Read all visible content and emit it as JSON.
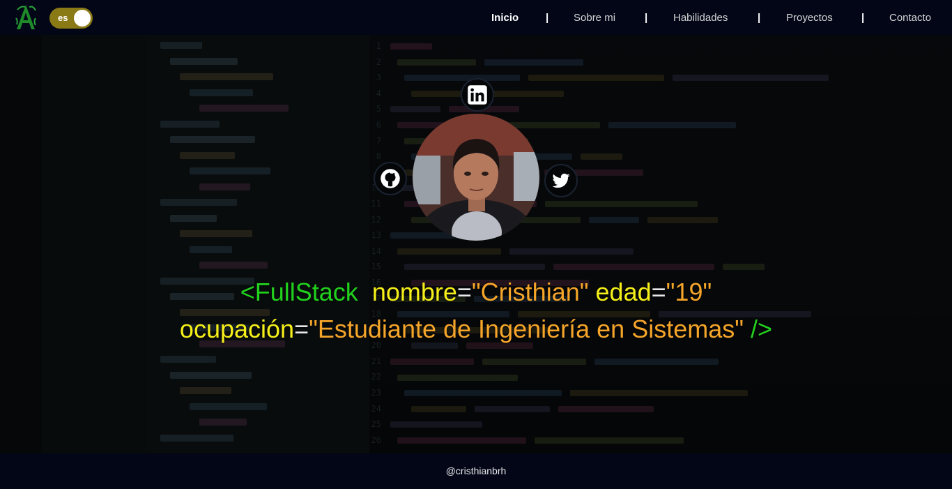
{
  "header": {
    "language_toggle": {
      "label": "es",
      "state": "on"
    },
    "nav": {
      "items": [
        "Inicio",
        "Sobre mi",
        "Habilidades",
        "Proyectos",
        "Contacto"
      ],
      "active": "Inicio",
      "separator": "|"
    }
  },
  "profile": {
    "social_links": [
      "linkedin-icon",
      "github-icon",
      "twitter-icon"
    ]
  },
  "headline": {
    "tag_open": "<FullStack",
    "attr_name": "nombre",
    "eq1": "=",
    "val_name": "\"Cristhian\"",
    "attr_age": "edad",
    "eq2": "=",
    "val_age": "\"19\"",
    "attr_occupation": "ocupación",
    "eq3": "=",
    "val_occupation": "\"Estudiante de Ingeniería en Sistemas\"",
    "tag_close": "/>"
  },
  "footer": {
    "handle": "@cristhianbrh"
  },
  "colors": {
    "header_bg": "#020617",
    "tag": "#22d11e",
    "attribute": "#f5ef1a",
    "string": "#f5a52a",
    "toggle_bg": "#8a7a16"
  }
}
